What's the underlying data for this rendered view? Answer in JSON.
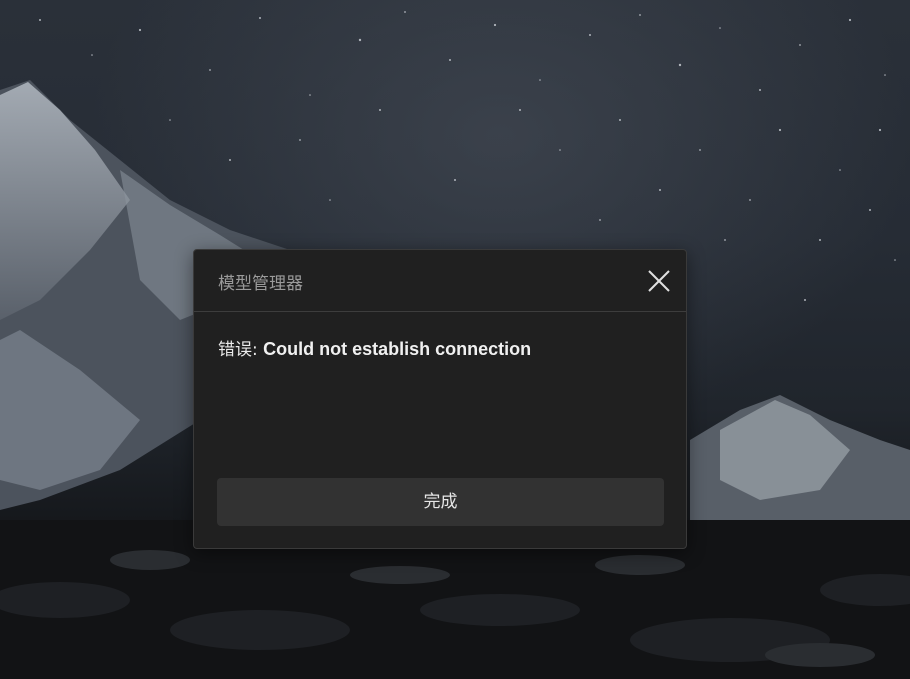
{
  "dialog": {
    "title": "模型管理器",
    "message_prefix": "错误: ",
    "message": "Could not establish connection",
    "done_label": "完成"
  },
  "icons": {
    "close": "close-icon"
  },
  "colors": {
    "dialog_bg": "#202020",
    "button_bg": "#323232",
    "title_text": "#9a9a9a",
    "message_text": "#f0f0f0"
  }
}
